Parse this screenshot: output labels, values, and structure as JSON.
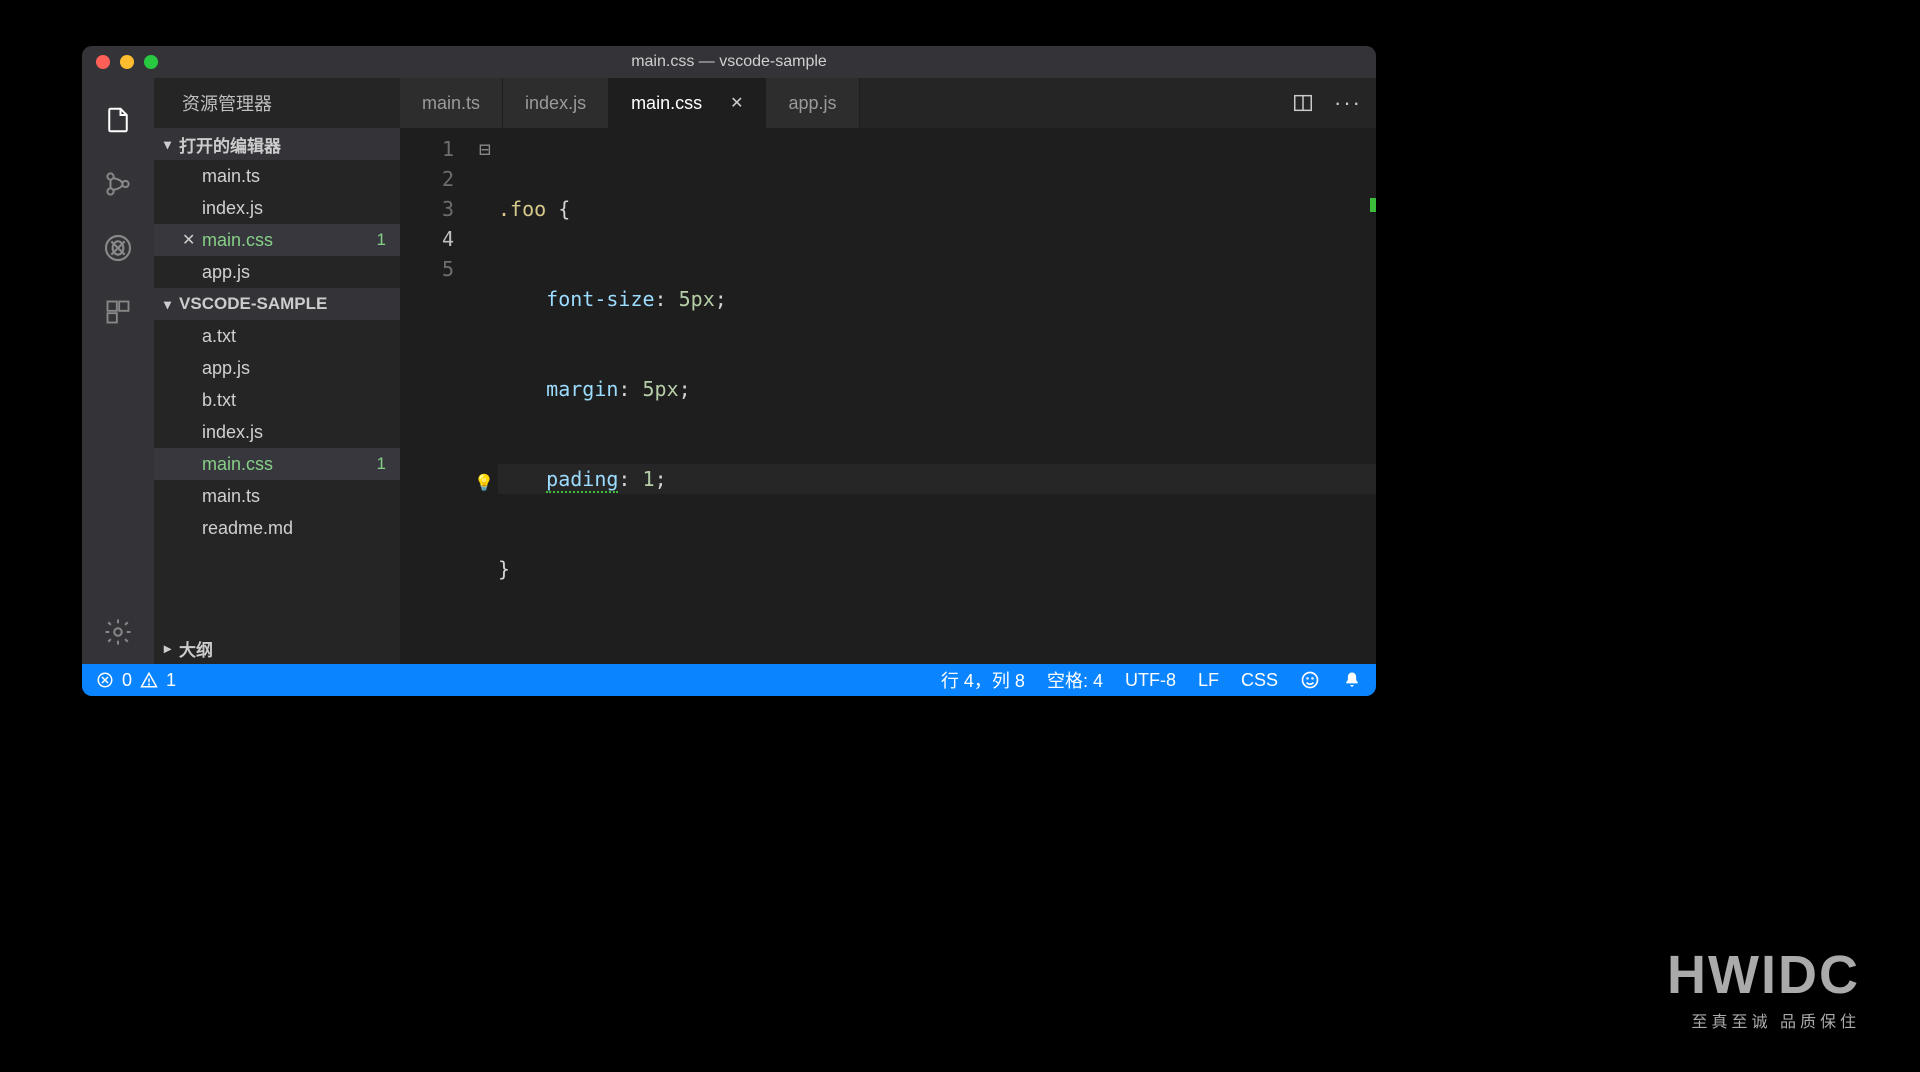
{
  "window": {
    "title": "main.css — vscode-sample"
  },
  "sidebar": {
    "title": "资源管理器",
    "openEditorsHeader": "打开的编辑器",
    "openEditors": [
      {
        "name": "main.ts",
        "modified": false
      },
      {
        "name": "index.js",
        "modified": false
      },
      {
        "name": "main.css",
        "modified": true,
        "badge": "1",
        "active": true
      },
      {
        "name": "app.js",
        "modified": false
      }
    ],
    "workspaceHeader": "VSCODE-SAMPLE",
    "files": [
      {
        "name": "a.txt"
      },
      {
        "name": "app.js"
      },
      {
        "name": "b.txt"
      },
      {
        "name": "index.js"
      },
      {
        "name": "main.css",
        "modified": true,
        "badge": "1",
        "selected": true
      },
      {
        "name": "main.ts"
      },
      {
        "name": "readme.md"
      }
    ],
    "outlineHeader": "大纲"
  },
  "tabs": [
    {
      "label": "main.ts",
      "active": false
    },
    {
      "label": "index.js",
      "active": false
    },
    {
      "label": "main.css",
      "active": true
    },
    {
      "label": "app.js",
      "active": false
    }
  ],
  "editor": {
    "lineNumbers": [
      "1",
      "2",
      "3",
      "4",
      "5"
    ],
    "currentLine": 4,
    "code": {
      "l1_sel": ".foo",
      "l1_brace": " {",
      "l2_prop": "font-size",
      "l2_val": "5px",
      "l3_prop": "margin",
      "l3_val": "5px",
      "l4_prop": "pading",
      "l4_val": "1",
      "l5_brace": "}"
    }
  },
  "statusbar": {
    "errors": "0",
    "warnings": "1",
    "lineCol": "行 4，列 8",
    "indent": "空格: 4",
    "encoding": "UTF-8",
    "eol": "LF",
    "language": "CSS"
  },
  "watermark": {
    "big": "HWIDC",
    "small": "至真至诚 品质保住"
  }
}
